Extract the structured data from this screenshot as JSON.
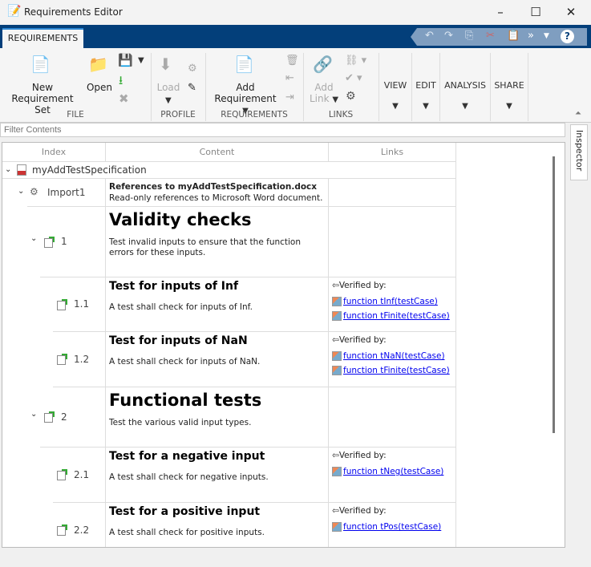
{
  "window": {
    "title": "Requirements Editor",
    "minimize": "–",
    "maximize": "☐",
    "close": "✕"
  },
  "tabs": [
    {
      "label": "REQUIREMENTS",
      "active": true
    }
  ],
  "ribbon": {
    "file": {
      "label": "FILE",
      "new": "New",
      "new2": "Requirement Set",
      "open": "Open"
    },
    "profile": {
      "label": "PROFILE",
      "load": "Load"
    },
    "requirements": {
      "label": "REQUIREMENTS",
      "add": "Add",
      "add2": "Requirement"
    },
    "links": {
      "label": "LINKS",
      "add": "Add",
      "add2": "Link"
    },
    "menus": [
      "VIEW",
      "EDIT",
      "ANALYSIS",
      "SHARE"
    ]
  },
  "filter": {
    "placeholder": "Filter Contents"
  },
  "inspector": "Inspector",
  "table": {
    "headers": [
      "Index",
      "Content",
      "Links"
    ],
    "root": "myAddTestSpecification",
    "import": {
      "index": "Import1",
      "title": "References to myAddTestSpecification.docx",
      "desc": "Read-only references to Microsoft Word document."
    },
    "rows": [
      {
        "index": "1",
        "title": "Validity checks",
        "desc": "Test invalid inputs to ensure that the function errors for these inputs.",
        "links": []
      },
      {
        "index": "1.1",
        "title": "Test for inputs of Inf",
        "desc": "A test shall check for inputs of Inf.",
        "verified": "Verified by:",
        "links": [
          "function tInf(testCase)",
          "function tFinite(testCase)"
        ]
      },
      {
        "index": "1.2",
        "title": "Test for inputs of NaN",
        "desc": "A test shall check for inputs of NaN.",
        "verified": "Verified by:",
        "links": [
          "function tNaN(testCase)",
          "function tFinite(testCase)"
        ]
      },
      {
        "index": "2",
        "title": "Functional tests",
        "desc": "Test the various valid input types.",
        "links": []
      },
      {
        "index": "2.1",
        "title": "Test for a negative input",
        "desc": "A test shall check for negative inputs.",
        "verified": "Verified by:",
        "links": [
          "function tNeg(testCase)"
        ]
      },
      {
        "index": "2.2",
        "title": "Test for a positive input",
        "desc": "A test shall check for positive inputs.",
        "verified": "Verified by:",
        "links": [
          "function tPos(testCase)"
        ]
      }
    ]
  }
}
